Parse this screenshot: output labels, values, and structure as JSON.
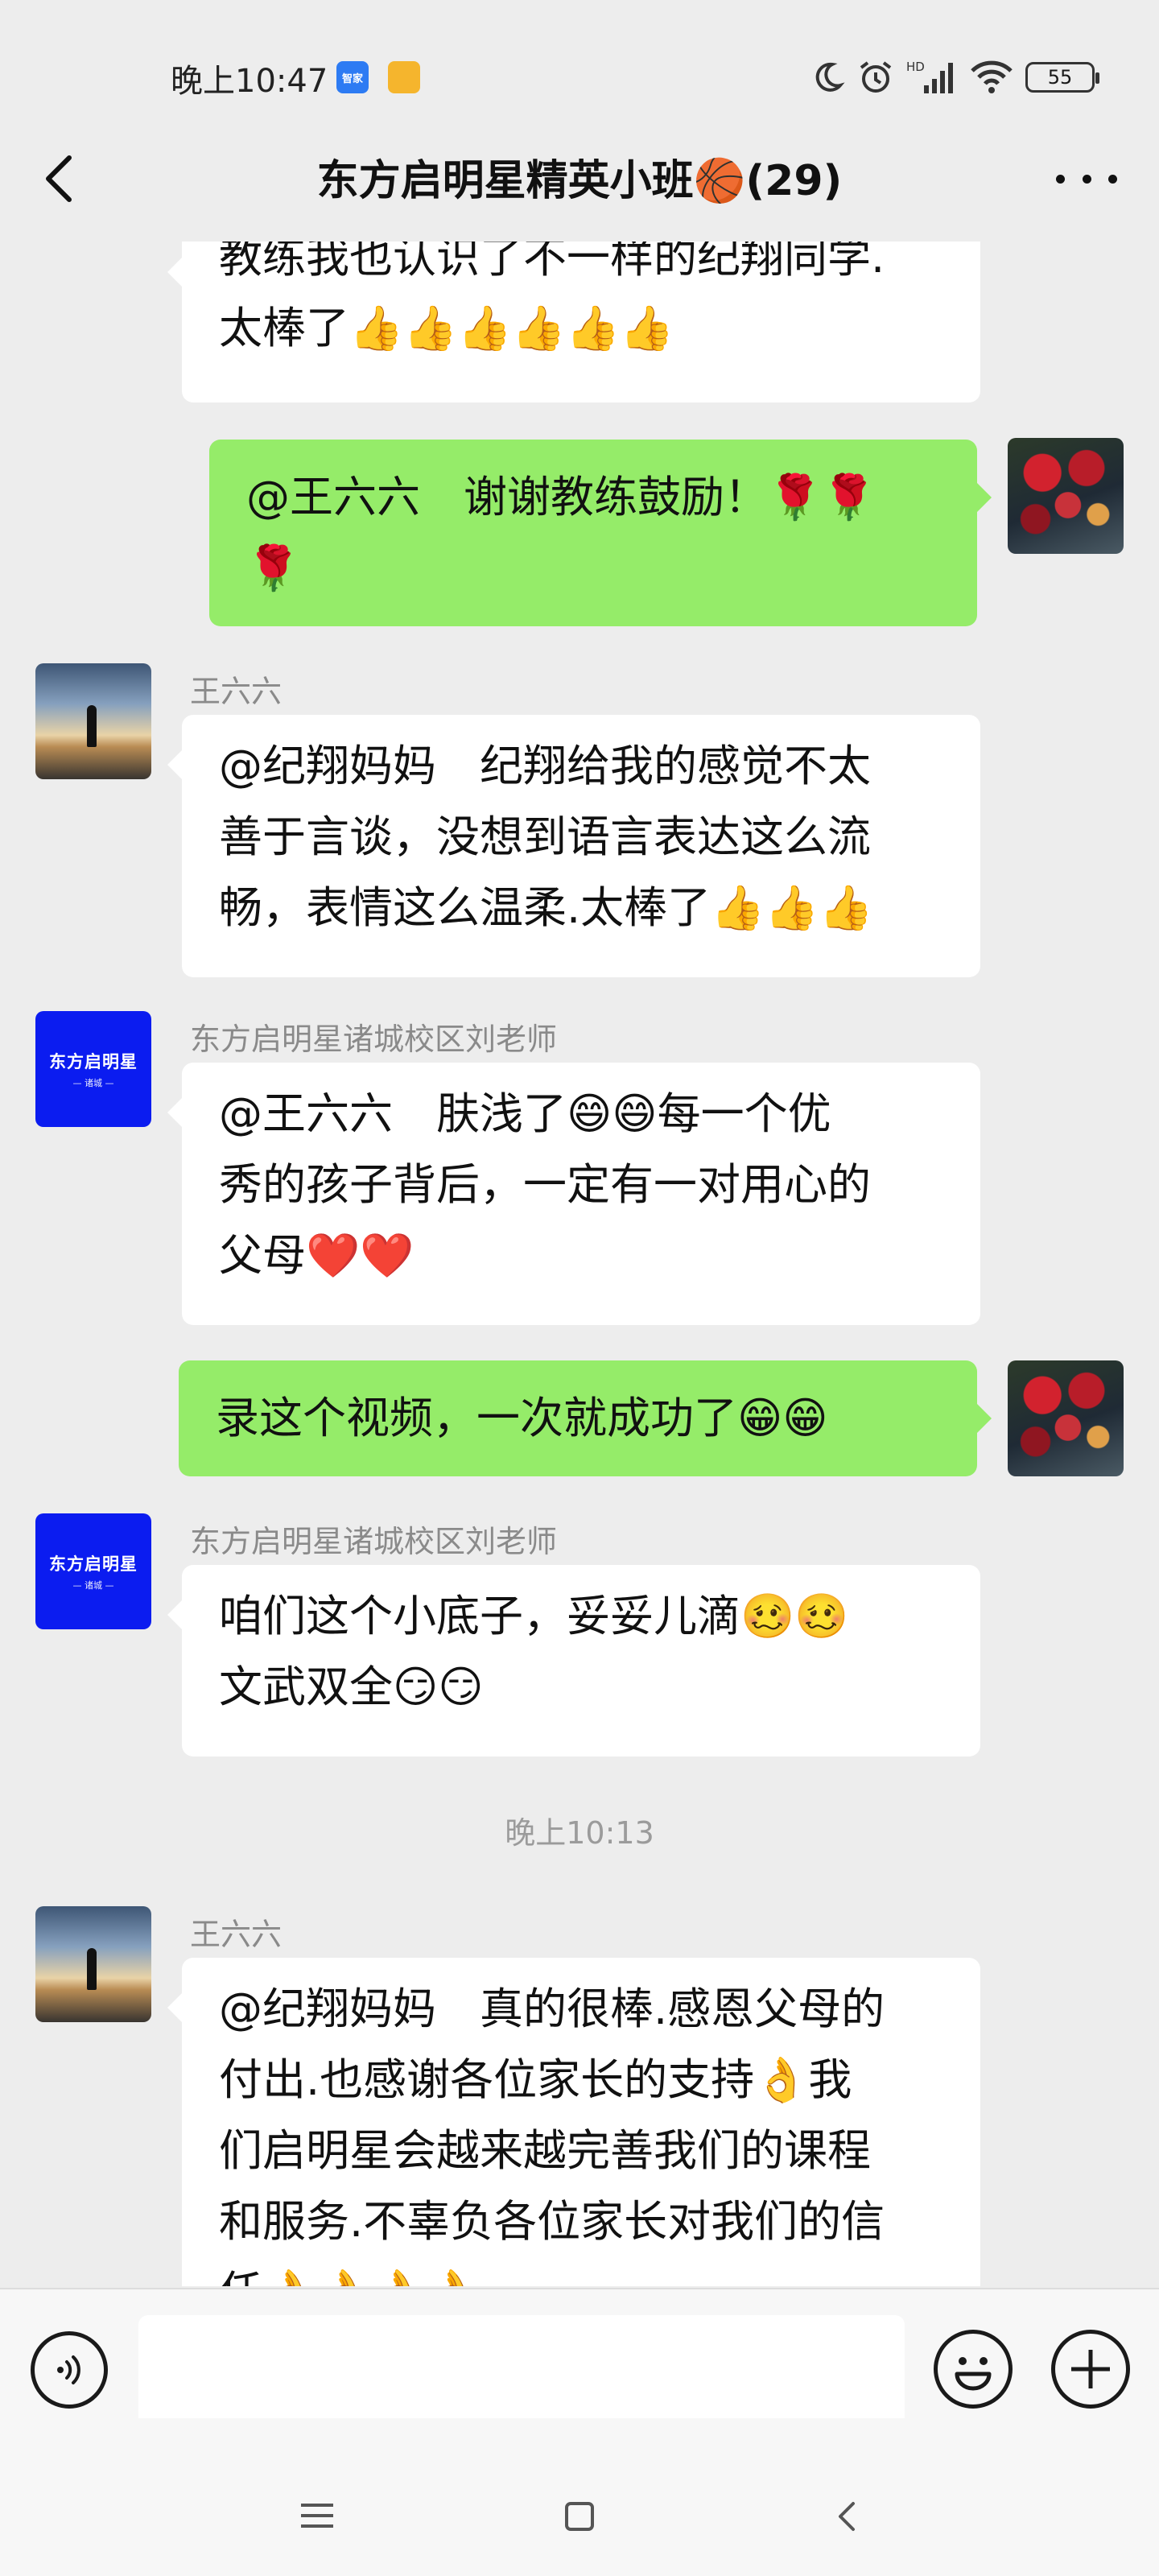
{
  "status_bar": {
    "time": "晚上10:47",
    "badge_1": "智家",
    "badge_2": "",
    "battery": "55",
    "icons": [
      "moon-icon",
      "alarm-icon",
      "hd-signal-icon",
      "wifi-icon",
      "battery-icon"
    ]
  },
  "header": {
    "title": "东方启明星精英小班🏀(29)",
    "icons": [
      "back-arrow-icon",
      "more-dots-icon"
    ]
  },
  "messages": [
    {
      "direction": "in",
      "sender": "",
      "avatar": "sunset-avatar",
      "text": "教练我也认识了不一样的纪翔同学.\n太棒了👍👍👍👍👍👍"
    },
    {
      "direction": "out",
      "avatar": "flowers-avatar",
      "text": "@王六六　谢谢教练鼓励！🌹🌹\n🌹"
    },
    {
      "direction": "in",
      "sender": "王六六",
      "avatar": "sunset-avatar",
      "text": "@纪翔妈妈　纪翔给我的感觉不太\n善于言谈，没想到语言表达这么流\n畅，表情这么温柔.太棒了👍👍👍"
    },
    {
      "direction": "in",
      "sender": "东方启明星诸城校区刘老师",
      "avatar": "logo-avatar",
      "text": "@王六六　肤浅了😄😄每一个优\n秀的孩子背后，一定有一对用心的\n父母❤️❤️"
    },
    {
      "direction": "out",
      "avatar": "flowers-avatar",
      "text": "录这个视频，一次就成功了😁😁"
    },
    {
      "direction": "in",
      "sender": "东方启明星诸城校区刘老师",
      "avatar": "logo-avatar",
      "text": "咱们这个小底子，妥妥儿滴🥴🥴\n文武双全😏😏"
    },
    {
      "direction": "in",
      "sender": "王六六",
      "avatar": "sunset-avatar",
      "text": "@纪翔妈妈　真的很棒.感恩父母的\n付出.也感谢各位家长的支持👌我\n们启明星会越来越完善我们的课程\n和服务.不辜负各位家长对我们的信\n任👌👌👌👌"
    }
  ],
  "timestamp": "晚上10:13",
  "logo": {
    "text": "东方启明星",
    "sub": "— 诸城 —"
  },
  "input_bar": {
    "placeholder": "",
    "icons": [
      "voice-icon",
      "emoji-icon",
      "plus-icon"
    ]
  },
  "nav_bar": {
    "icons": [
      "menu-icon",
      "home-icon",
      "back-icon"
    ]
  }
}
